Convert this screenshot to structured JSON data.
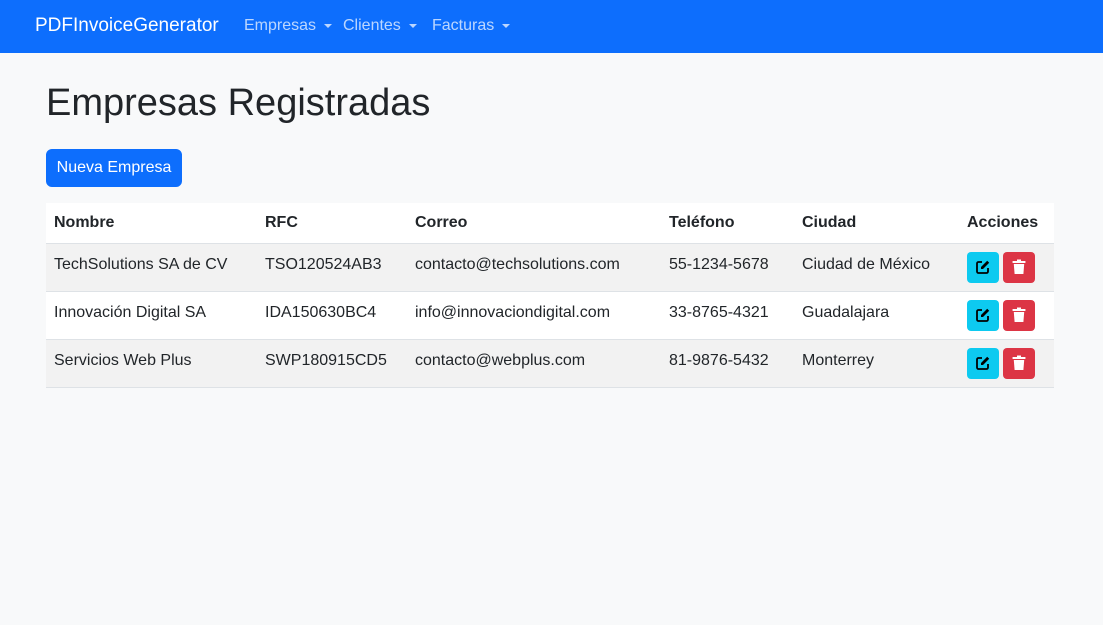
{
  "navbar": {
    "brand": "PDFInvoiceGenerator",
    "items": [
      {
        "label": "Empresas"
      },
      {
        "label": "Clientes"
      },
      {
        "label": "Facturas"
      }
    ]
  },
  "page": {
    "title": "Empresas Registradas",
    "new_button": "Nueva Empresa"
  },
  "table": {
    "headers": [
      "Nombre",
      "RFC",
      "Correo",
      "Teléfono",
      "Ciudad",
      "Acciones"
    ],
    "rows": [
      {
        "nombre": "TechSolutions SA de CV",
        "rfc": "TSO120524AB3",
        "correo": "contacto@techsolutions.com",
        "telefono": "55-1234-5678",
        "ciudad": "Ciudad de México"
      },
      {
        "nombre": "Innovación Digital SA",
        "rfc": "IDA150630BC4",
        "correo": "info@innovaciondigital.com",
        "telefono": "33-8765-4321",
        "ciudad": "Guadalajara"
      },
      {
        "nombre": "Servicios Web Plus",
        "rfc": "SWP180915CD5",
        "correo": "contacto@webplus.com",
        "telefono": "81-9876-5432",
        "ciudad": "Monterrey"
      }
    ],
    "action_icons": {
      "edit": "edit-icon",
      "delete": "trash-icon"
    }
  },
  "colors": {
    "primary": "#0d6efd",
    "info": "#0dcaf0",
    "danger": "#dc3545",
    "background": "#f8f9fa"
  }
}
